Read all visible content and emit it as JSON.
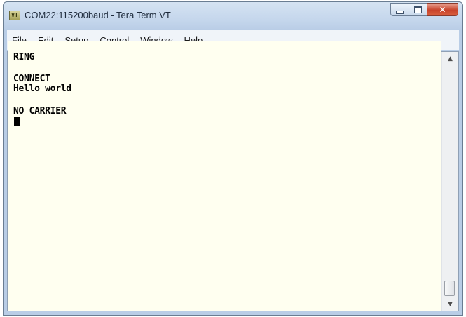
{
  "window": {
    "title": "COM22:115200baud - Tera Term VT",
    "app_icon_label": "VT",
    "controls": {
      "minimize_icon": "minimize-icon",
      "maximize_icon": "maximize-icon",
      "close_icon": "close-icon"
    }
  },
  "menu": {
    "items": [
      "File",
      "Edit",
      "Setup",
      "Control",
      "Window",
      "Help"
    ]
  },
  "terminal": {
    "lines": [
      "RING",
      "",
      "CONNECT",
      "Hello world",
      "",
      "NO CARRIER"
    ],
    "background": "#fffff0",
    "foreground": "#000000"
  },
  "scrollbar": {
    "up_arrow": "▲",
    "down_arrow": "▼"
  }
}
